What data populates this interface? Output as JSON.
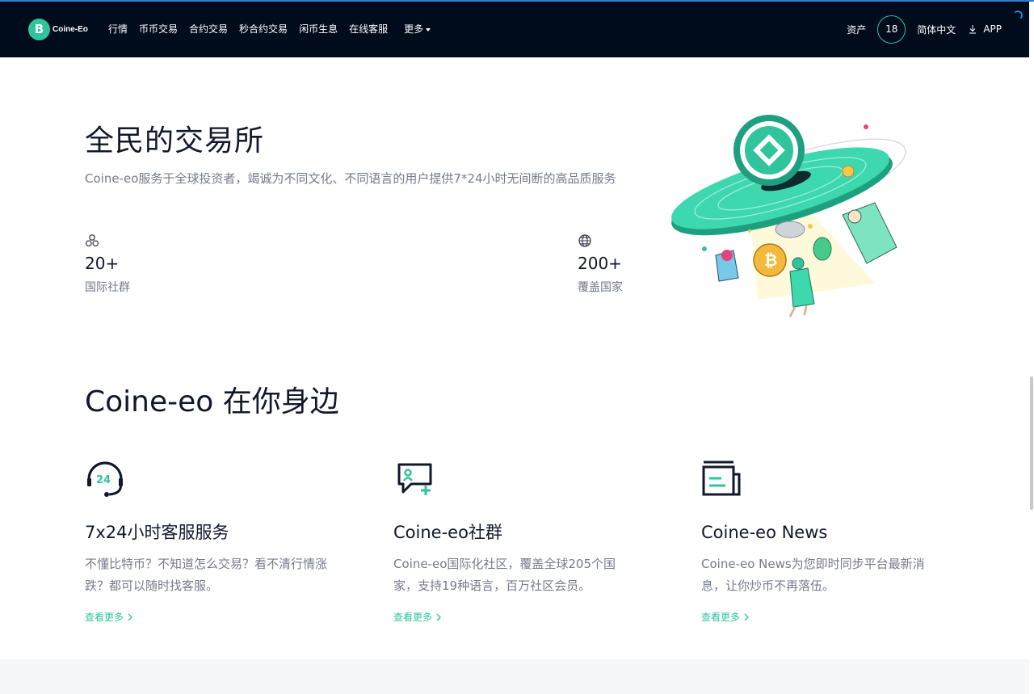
{
  "header": {
    "logo_text": "Coine-Eo",
    "logo_glyph": "B",
    "nav": [
      "行情",
      "币币交易",
      "合约交易",
      "秒合约交易",
      "闲币生息",
      "在线客服"
    ],
    "more_label": "更多",
    "assets_label": "资产",
    "badge_count": "18",
    "language_label": "简体中文",
    "app_label": "APP"
  },
  "hero": {
    "title": "全民的交易所",
    "description": "Coine-eo服务于全球投资者，竭诚为不同文化、不同语言的用户提供7*24小时无间断的高品质服务",
    "stats": [
      {
        "icon": "community-icon",
        "value": "20+",
        "label": "国际社群"
      },
      {
        "icon": "globe-icon",
        "value": "200+",
        "label": "覆盖国家"
      }
    ]
  },
  "section": {
    "title": "Coine-eo 在你身边",
    "features": [
      {
        "icon": "headset-24-icon",
        "title": "7x24小时客服服务",
        "desc": "不懂比特币？不知道怎么交易？看不清行情涨跌？都可以随时找客服。",
        "link": "查看更多"
      },
      {
        "icon": "chat-add-icon",
        "title": "Coine-eo社群",
        "desc": "Coine-eo国际化社区，覆盖全球205个国家，支持19种语言，百万社区会员。",
        "link": "查看更多"
      },
      {
        "icon": "news-icon",
        "title": "Coine-eo News",
        "desc": "Coine-eo News为您即时同步平台最新消息，让你炒币不再落伍。",
        "link": "查看更多"
      }
    ]
  },
  "colors": {
    "header_bg": "#000b1b",
    "accent": "#2fc49c",
    "text_dark": "#11182b",
    "text_muted": "#767b8c"
  }
}
